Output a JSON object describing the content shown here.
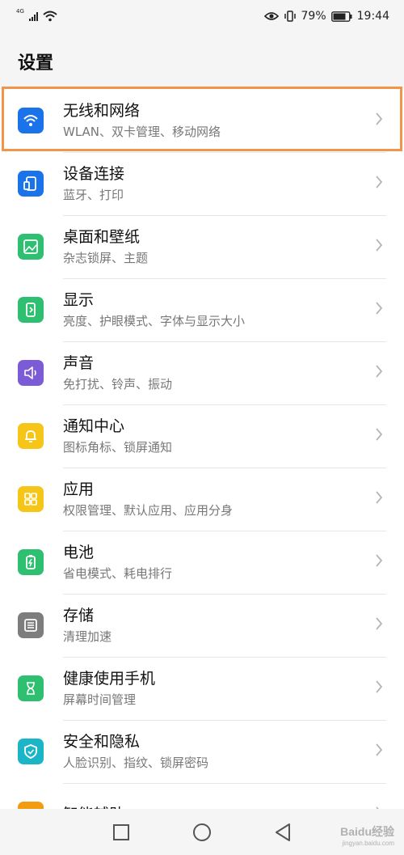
{
  "status_bar": {
    "network": "4G",
    "battery": "79%",
    "time": "19:44"
  },
  "page": {
    "title": "设置"
  },
  "settings": [
    {
      "title": "无线和网络",
      "subtitle": "WLAN、双卡管理、移动网络",
      "icon": "wifi-icon",
      "color": "#1a73e8"
    },
    {
      "title": "设备连接",
      "subtitle": "蓝牙、打印",
      "icon": "device-connection-icon",
      "color": "#1a73e8"
    },
    {
      "title": "桌面和壁纸",
      "subtitle": "杂志锁屏、主题",
      "icon": "wallpaper-icon",
      "color": "#2fbf71"
    },
    {
      "title": "显示",
      "subtitle": "亮度、护眼模式、字体与显示大小",
      "icon": "display-icon",
      "color": "#2fbf71"
    },
    {
      "title": "声音",
      "subtitle": "免打扰、铃声、振动",
      "icon": "sound-icon",
      "color": "#7b5cd6"
    },
    {
      "title": "通知中心",
      "subtitle": "图标角标、锁屏通知",
      "icon": "bell-icon",
      "color": "#f5c518"
    },
    {
      "title": "应用",
      "subtitle": "权限管理、默认应用、应用分身",
      "icon": "apps-icon",
      "color": "#f5c518"
    },
    {
      "title": "电池",
      "subtitle": "省电模式、耗电排行",
      "icon": "battery-icon",
      "color": "#2fbf71"
    },
    {
      "title": "存储",
      "subtitle": "清理加速",
      "icon": "storage-icon",
      "color": "#7d7d7d"
    },
    {
      "title": "健康使用手机",
      "subtitle": "屏幕时间管理",
      "icon": "hourglass-icon",
      "color": "#2fbf71"
    },
    {
      "title": "安全和隐私",
      "subtitle": "人脸识别、指纹、锁屏密码",
      "icon": "shield-icon",
      "color": "#1cb5c8"
    },
    {
      "title": "智能辅助",
      "subtitle": "",
      "icon": "assist-icon",
      "color": "#f39c12"
    }
  ],
  "highlight_color": "#f0954a"
}
